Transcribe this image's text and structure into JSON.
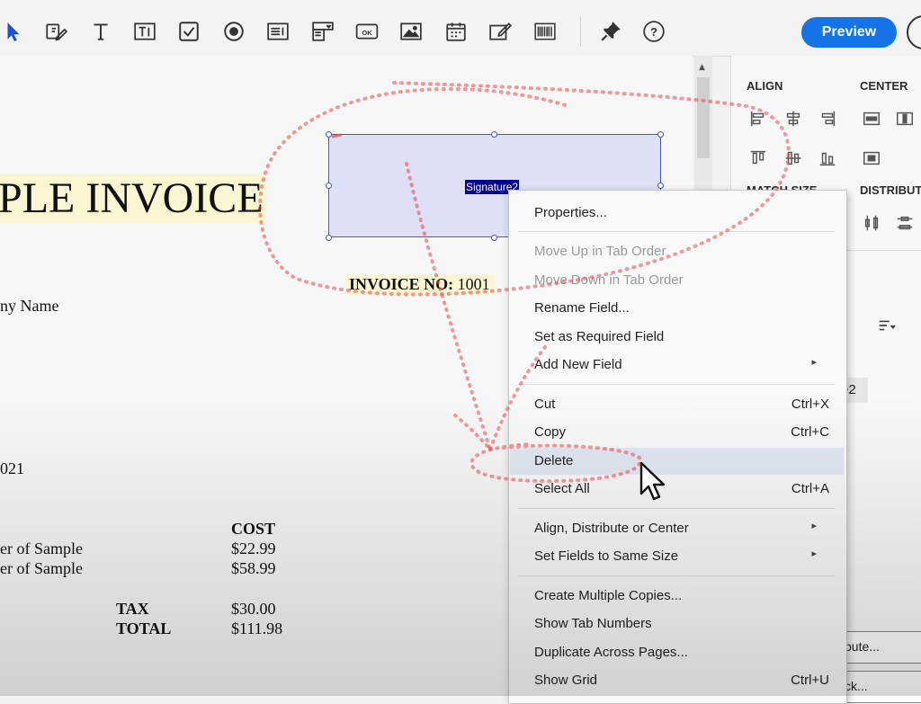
{
  "toolbar": {
    "tools": [
      "select-icon",
      "edit-field-icon",
      "text-field-icon",
      "text-box-icon",
      "checkbox-icon",
      "radio-button-icon",
      "list-box-icon",
      "dropdown-icon",
      "button-icon",
      "image-icon",
      "date-field-icon",
      "signature-icon",
      "barcode-icon",
      "pin-icon",
      "help-icon"
    ],
    "preview_label": "Preview",
    "accent": "#1473e6"
  },
  "document": {
    "title": "PLE INVOICE",
    "company": "ny Name",
    "invoice_no_label": "INVOICE NO:",
    "invoice_no_value": "1001",
    "date_fragment": "021",
    "cost_header": "COST",
    "items": [
      {
        "desc": "er of Sample",
        "cost": "$22.99"
      },
      {
        "desc": "er of Sample",
        "cost": "$58.99"
      }
    ],
    "tax_label": "TAX",
    "tax_value": "$30.00",
    "total_label": "TOTAL",
    "total_value": "$111.98"
  },
  "field": {
    "name": "Signature2",
    "border_color": "#4a55c7"
  },
  "panel": {
    "align_title": "ALIGN",
    "center_title": "CENTER",
    "match_size_title": "MATCH SIZE",
    "distribute_title": "DISTRIBUTE",
    "field_name_fragment": "e2",
    "btn_fragment_1": "bute...",
    "btn_fragment_2": "ck..."
  },
  "context_menu": {
    "items": [
      {
        "label": "Properties...",
        "shortcut": "",
        "disabled": false,
        "submenu": false
      },
      {
        "label": "Move Up in Tab Order",
        "shortcut": "",
        "disabled": true,
        "submenu": false
      },
      {
        "label": "Move Down in Tab Order",
        "shortcut": "",
        "disabled": true,
        "submenu": false
      },
      {
        "label": "Rename Field...",
        "shortcut": "",
        "disabled": false,
        "submenu": false
      },
      {
        "label": "Set as Required Field",
        "shortcut": "",
        "disabled": false,
        "submenu": false
      },
      {
        "label": "Add New Field",
        "shortcut": "",
        "disabled": false,
        "submenu": true
      },
      {
        "label": "Cut",
        "shortcut": "Ctrl+X",
        "disabled": false,
        "submenu": false
      },
      {
        "label": "Copy",
        "shortcut": "Ctrl+C",
        "disabled": false,
        "submenu": false
      },
      {
        "label": "Delete",
        "shortcut": "",
        "disabled": false,
        "submenu": false,
        "highlighted": true
      },
      {
        "label": "Select All",
        "shortcut": "Ctrl+A",
        "disabled": false,
        "submenu": false
      },
      {
        "label": "Align, Distribute or Center",
        "shortcut": "",
        "disabled": false,
        "submenu": true
      },
      {
        "label": "Set Fields to Same Size",
        "shortcut": "",
        "disabled": false,
        "submenu": true
      },
      {
        "label": "Create Multiple Copies...",
        "shortcut": "",
        "disabled": false,
        "submenu": false
      },
      {
        "label": "Show Tab Numbers",
        "shortcut": "",
        "disabled": false,
        "submenu": false
      },
      {
        "label": "Duplicate Across Pages...",
        "shortcut": "",
        "disabled": false,
        "submenu": false
      },
      {
        "label": "Show Grid",
        "shortcut": "Ctrl+U",
        "disabled": false,
        "submenu": false
      }
    ],
    "submenu_glyph": "▸"
  },
  "annotation": {
    "color": "#e8474a"
  }
}
